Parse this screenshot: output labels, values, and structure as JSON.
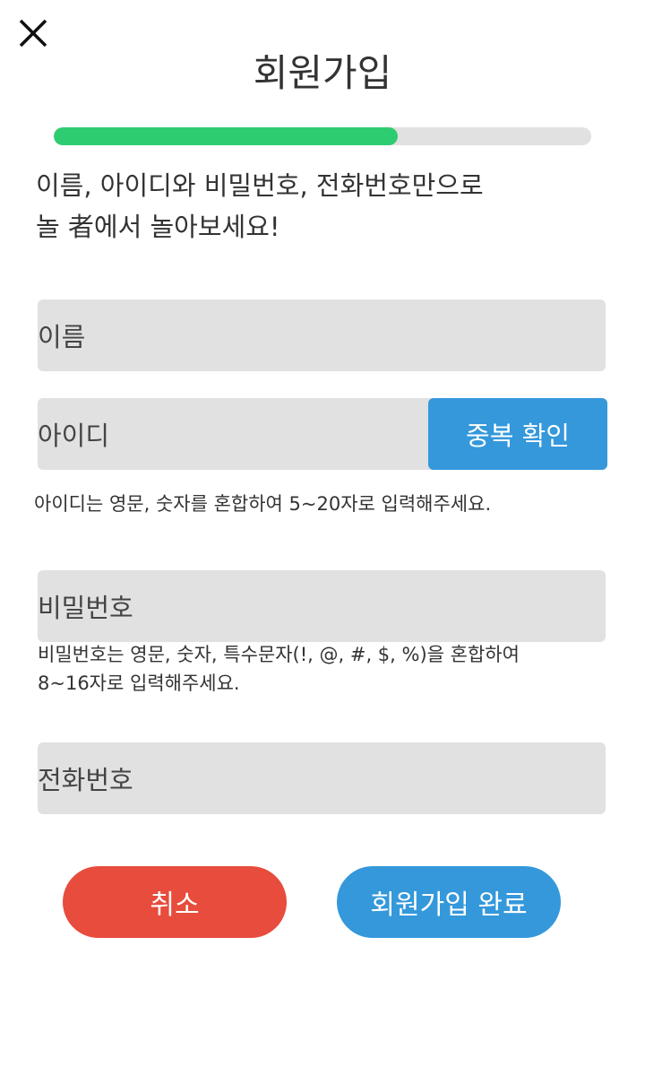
{
  "header": {
    "title": "회원가입",
    "close_icon": "close-icon"
  },
  "progress": {
    "progress_percent": 64,
    "fill_color": "#2ecc71",
    "track_color": "#e1e1e1"
  },
  "intro": {
    "line1": "이름, 아이디와 비밀번호, 전화번호만으로",
    "line2": "놀 者에서 놀아보세요!"
  },
  "form": {
    "name_placeholder": "이름",
    "id_placeholder": "아이디",
    "dup_check_label": "중복 확인",
    "id_hint": "아이디는 영문, 숫자를 혼합하여 5~20자로 입력해주세요.",
    "password_placeholder": "비밀번호",
    "password_hint_line1": "비밀번호는 영문, 숫자, 특수문자(!, @, #, $, %)을 혼합하여",
    "password_hint_line2": "8~16자로 입력해주세요.",
    "phone_placeholder": "전화번호"
  },
  "actions": {
    "cancel_label": "취소",
    "submit_label": "회원가입 완료",
    "cancel_color": "#e74c3c",
    "submit_color": "#3498db"
  }
}
